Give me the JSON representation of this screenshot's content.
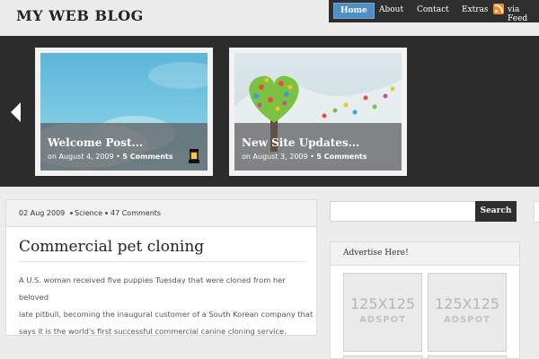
{
  "header": {
    "logo": "MY WEB BLOG",
    "nav": [
      {
        "label": "Home",
        "active": true
      },
      {
        "label": "About",
        "active": false
      },
      {
        "label": "Contact",
        "active": false
      },
      {
        "label": "Extras",
        "active": false
      }
    ],
    "feed_label": "via Feed",
    "feed_icon": "rss-icon"
  },
  "featured": {
    "prev_icon": "arrow-left-icon",
    "cards": [
      {
        "title": "Welcome Post...",
        "date": "on August 4, 2009",
        "comments": "5 Comments"
      },
      {
        "title": "New Site Updates...",
        "date": "on August 3, 2009",
        "comments": "5 Comments"
      }
    ]
  },
  "post": {
    "date": "02 Aug 2009",
    "category": "Science",
    "comments": "47 Comments",
    "title": "Commercial pet cloning",
    "excerpt_lines": [
      "A U.S. woman received five puppies Tuesday that were cloned from her beloved",
      "late pitbull, becoming the inaugural customer of a South Korean company that",
      "says it is the world's first successful commercial canine cloning service."
    ]
  },
  "sidebar": {
    "search_button": "Search",
    "search_placeholder": "",
    "ad_title": "Advertise Here!",
    "ad_spots": [
      {
        "size": "125X125",
        "label": "ADSPOT"
      },
      {
        "size": "125X125",
        "label": "ADSPOT"
      }
    ]
  },
  "colors": {
    "nav_bg": "#2f2f2f",
    "active_tab": "#4f8fc6",
    "featured_bg": "#2c2c2c",
    "page_bg": "#ececec",
    "rss": "#f58a1f"
  }
}
